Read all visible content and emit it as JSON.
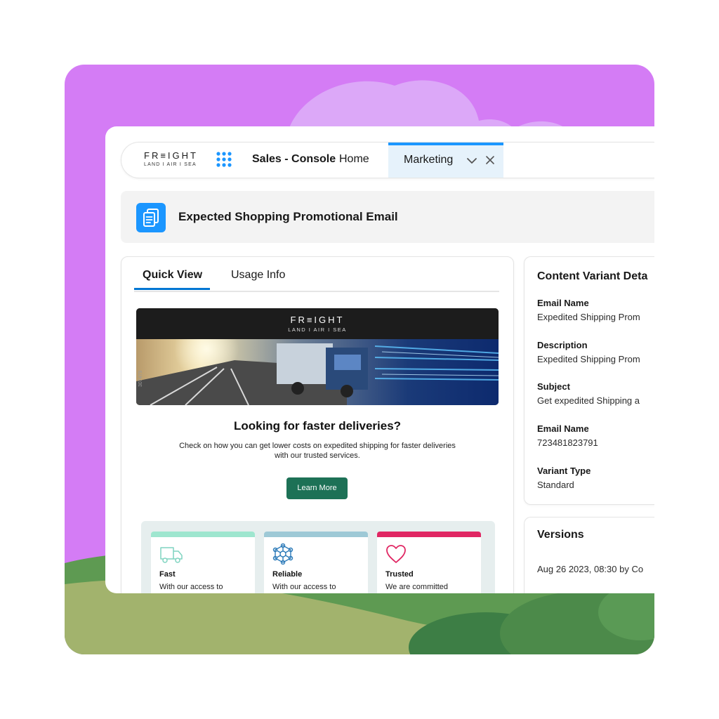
{
  "brand": {
    "logo_word": "FR≡IGHT",
    "logo_sub": "LAND I AIR I SEA"
  },
  "nav": {
    "app_name": "Sales - Console",
    "home": "Home",
    "active_tab": "Marketing"
  },
  "record": {
    "title": "Expected Shopping Promotional Email"
  },
  "left_card": {
    "tabs": [
      "Quick View",
      "Usage Info"
    ],
    "email_preview": {
      "image_code": "307479",
      "headline": "Looking for faster deliveries?",
      "body": "Check on how you can get lower costs on expedited shipping for faster deliveries with our trusted services.",
      "cta": "Learn More",
      "features": [
        {
          "title": "Fast",
          "desc": "With our access to",
          "color": "#9ee6cf"
        },
        {
          "title": "Reliable",
          "desc": "With our access to",
          "color": "#9ec9d6"
        },
        {
          "title": "Trusted",
          "desc": "We are committed",
          "color": "#e02763"
        }
      ]
    }
  },
  "details": {
    "title": "Content Variant Deta",
    "fields": [
      {
        "label": "Email Name",
        "value": "Expedited Shipping Prom"
      },
      {
        "label": "Description",
        "value": "Expedited Shipping Prom"
      },
      {
        "label": "Subject",
        "value": "Get expedited Shipping a"
      },
      {
        "label": "Email Name",
        "value": "723481823791"
      },
      {
        "label": "Variant Type",
        "value": "Standard"
      }
    ]
  },
  "versions": {
    "title": "Versions",
    "items": [
      "Aug 26 2023, 08:30 by Co"
    ]
  },
  "colors": {
    "background": "#d47cf5",
    "accent": "#1b96ff",
    "cta": "#1d7156",
    "tab_active_bg": "#e6f2fb"
  }
}
